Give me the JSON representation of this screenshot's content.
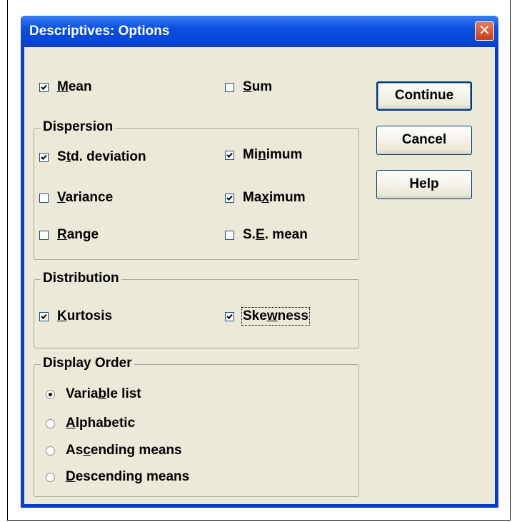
{
  "window": {
    "title": "Descriptives: Options",
    "close_glyph": "✕"
  },
  "checks": {
    "mean": {
      "pre": "",
      "acc": "M",
      "post": "ean",
      "checked": true
    },
    "sum": {
      "pre": "",
      "acc": "S",
      "post": "um",
      "checked": false
    }
  },
  "dispersion": {
    "title": "Dispersion",
    "std": {
      "pre": "S",
      "acc": "t",
      "post": "d. deviation",
      "checked": true
    },
    "minimum": {
      "pre": "Mi",
      "acc": "n",
      "post": "imum",
      "checked": true
    },
    "variance": {
      "pre": "",
      "acc": "V",
      "post": "ariance",
      "checked": false
    },
    "maximum": {
      "pre": "Ma",
      "acc": "x",
      "post": "imum",
      "checked": true
    },
    "range": {
      "pre": "",
      "acc": "R",
      "post": "ange",
      "checked": false
    },
    "semean": {
      "pre": "S.",
      "acc": "E",
      "post": ". mean",
      "checked": false
    }
  },
  "distribution": {
    "title": "Distribution",
    "kurtosis": {
      "pre": "",
      "acc": "K",
      "post": "urtosis",
      "checked": true
    },
    "skewness": {
      "pre": "Ske",
      "acc": "w",
      "post": "ness",
      "checked": true
    }
  },
  "display_order": {
    "title": "Display Order",
    "variable": {
      "pre": "Varia",
      "acc": "b",
      "post": "le list",
      "selected": true
    },
    "alphabetic": {
      "pre": "",
      "acc": "A",
      "post": "lphabetic",
      "selected": false
    },
    "ascending": {
      "pre": "As",
      "acc": "c",
      "post": "ending means",
      "selected": false
    },
    "descending": {
      "pre": "",
      "acc": "D",
      "post": "escending means",
      "selected": false
    }
  },
  "buttons": {
    "continue": "Continue",
    "cancel": "Cancel",
    "help": "Help"
  },
  "icons": {
    "checkbox_checked": "checkmark-icon",
    "radio_selected": "radio-dot-icon",
    "close": "close-icon"
  },
  "colors": {
    "titlebar": "#0a50e0",
    "client": "#ece9d8",
    "button_border": "#003c74",
    "close": "#c2401e"
  }
}
